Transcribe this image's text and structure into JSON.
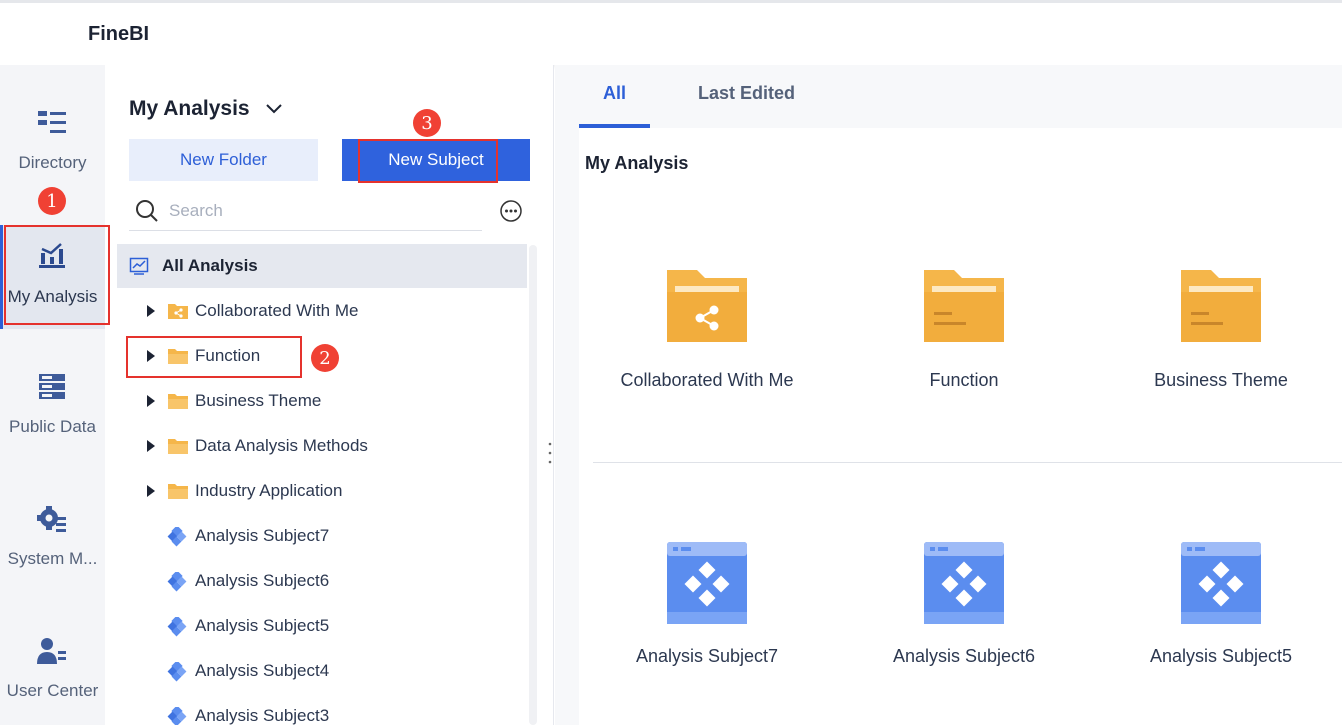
{
  "app": {
    "title": "FineBI"
  },
  "rail": {
    "items": [
      {
        "label": "Directory",
        "icon": "directory-icon"
      },
      {
        "label": "My Analysis",
        "icon": "my-analysis-icon",
        "active": true
      },
      {
        "label": "Public Data",
        "icon": "public-data-icon"
      },
      {
        "label": "System M...",
        "icon": "system-management-icon"
      },
      {
        "label": "User Center",
        "icon": "user-center-icon"
      }
    ]
  },
  "panel": {
    "title": "My Analysis",
    "new_folder_label": "New Folder",
    "new_subject_label": "New Subject",
    "search_placeholder": "Search",
    "tree": [
      {
        "label": "All Analysis",
        "icon": "analysis-chart-icon",
        "root": true
      },
      {
        "label": "Collaborated With Me",
        "icon": "shared-folder-icon",
        "expandable": true
      },
      {
        "label": "Function",
        "icon": "folder-icon",
        "expandable": true
      },
      {
        "label": "Business Theme",
        "icon": "folder-icon",
        "expandable": true
      },
      {
        "label": "Data Analysis Methods",
        "icon": "folder-icon",
        "expandable": true
      },
      {
        "label": "Industry Application",
        "icon": "folder-icon",
        "expandable": true
      },
      {
        "label": "Analysis Subject7",
        "icon": "subject-icon"
      },
      {
        "label": "Analysis Subject6",
        "icon": "subject-icon"
      },
      {
        "label": "Analysis Subject5",
        "icon": "subject-icon"
      },
      {
        "label": "Analysis Subject4",
        "icon": "subject-icon"
      },
      {
        "label": "Analysis Subject3",
        "icon": "subject-icon"
      }
    ]
  },
  "content": {
    "tabs": [
      {
        "label": "All",
        "active": true
      },
      {
        "label": "Last Edited"
      }
    ],
    "section_title": "My Analysis",
    "folders": [
      {
        "label": "Collaborated With Me",
        "icon": "shared-folder-icon"
      },
      {
        "label": "Function",
        "icon": "folder-icon"
      },
      {
        "label": "Business Theme",
        "icon": "folder-icon"
      }
    ],
    "subjects": [
      {
        "label": "Analysis Subject7",
        "icon": "subject-icon"
      },
      {
        "label": "Analysis Subject6",
        "icon": "subject-icon"
      },
      {
        "label": "Analysis Subject5",
        "icon": "subject-icon"
      }
    ]
  },
  "annotations": {
    "step1": "1",
    "step2": "2",
    "step3": "3"
  },
  "colors": {
    "accent": "#2f62dd",
    "folder": "#f5b64a",
    "subject": "#5b8def",
    "marker": "#f04134"
  }
}
